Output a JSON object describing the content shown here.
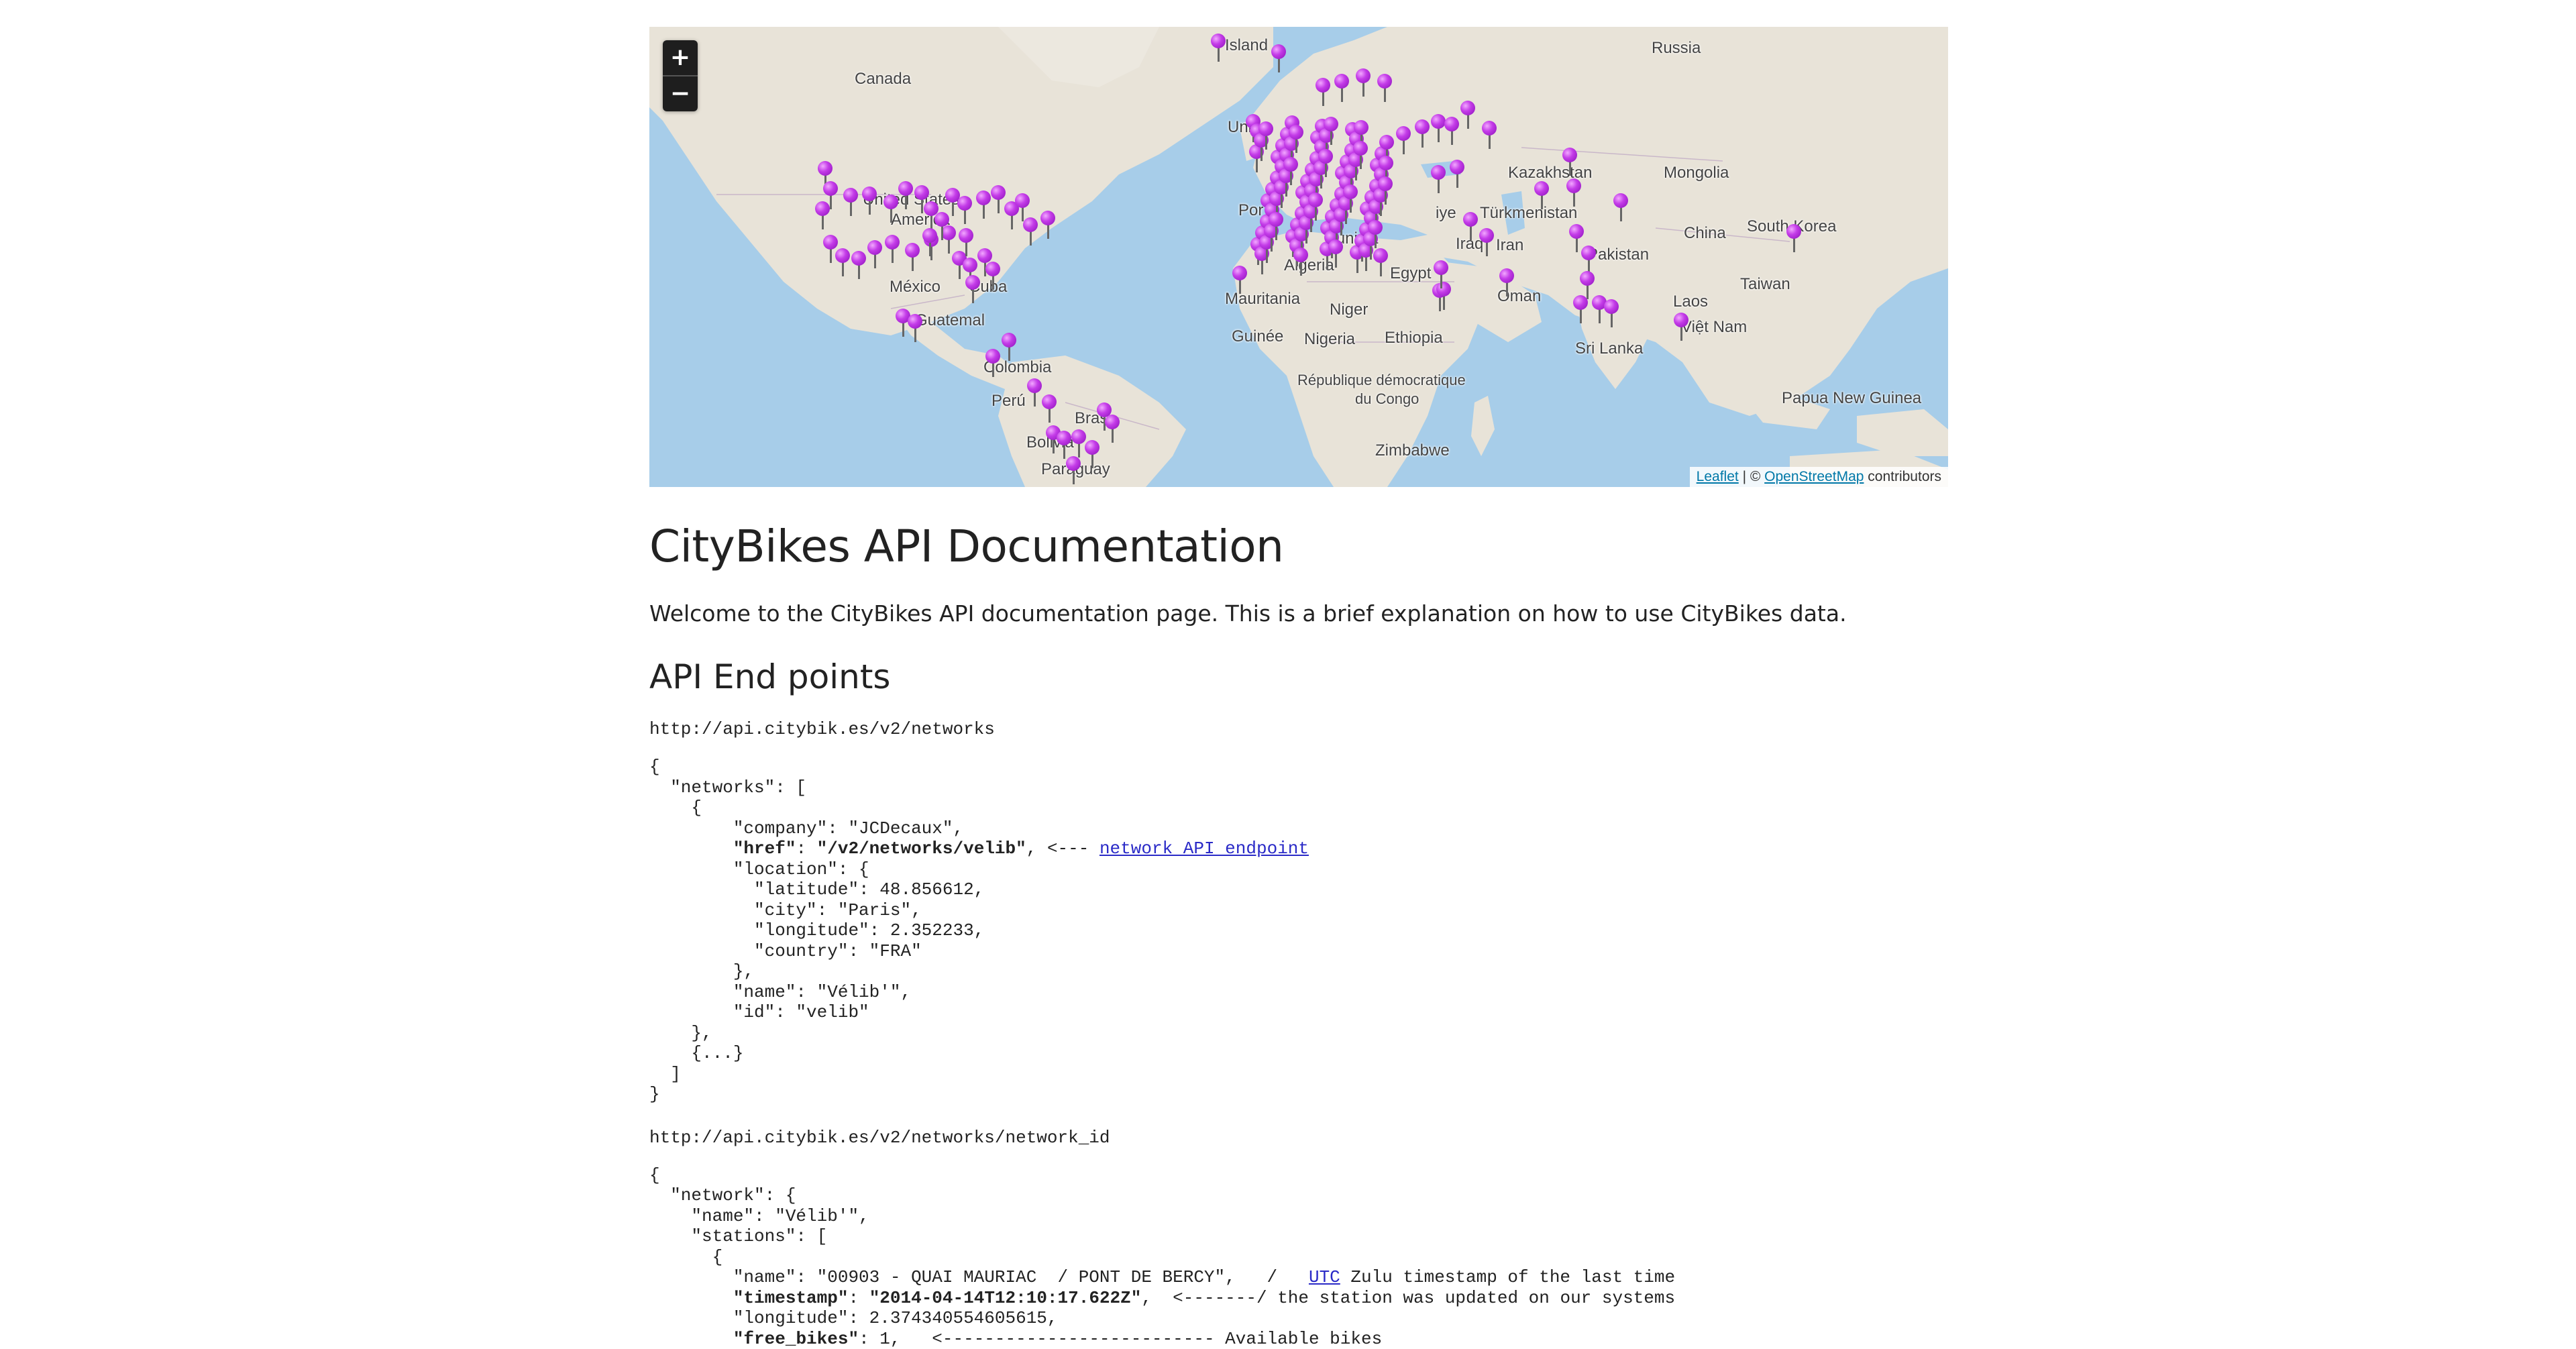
{
  "map": {
    "zoom_in": "+",
    "zoom_out": "−",
    "attribution": {
      "leaflet": "Leaflet",
      "separator": " | © ",
      "osm": "OpenStreetMap",
      "suffix": " contributors"
    },
    "labels": {
      "iceland": "Island",
      "russia": "Russia",
      "canada": "Canada",
      "united_kingdom": "Unit",
      "kazakhstan": "Kazakhstan",
      "mongolia": "Mongolia",
      "turkmenistan": "Türkmenistan",
      "united_states": "United States",
      "america": "America",
      "china": "China",
      "south_korea": "South Korea",
      "turkey": "iye",
      "portugal": "Por",
      "tunisia": "Tunisia",
      "iraq": "Iraq",
      "iran": "Iran",
      "pakistan": "Pakistan",
      "mexico": "México",
      "cuba": "Cuba",
      "algeria": "Algeria",
      "egypt": "Egypt",
      "taiwan": "Taiwan",
      "oman": "Oman",
      "guatemala": "Guatemal",
      "mauritania": "Mauritania",
      "niger": "Niger",
      "laos": "Laos",
      "vietnam": "Việt Nam",
      "colombia": "Colombia",
      "guinea": "Guinée",
      "nigeria": "Nigeria",
      "ethiopia": "Ethiopia",
      "sri_lanka": "Sri Lanka",
      "drc1": "République démocratique",
      "drc2": "du Congo",
      "peru": "Perú",
      "papua": "Papua New Guinea",
      "brazil": "Bras",
      "bolivia": "Bolivia",
      "zimbabwe": "Zimbabwe",
      "paraguay": "Paraguay"
    }
  },
  "doc": {
    "title": "CityBikes API Documentation",
    "intro": "Welcome to the CityBikes API documentation page. This is a brief explanation on how to use CityBikes data.",
    "endpoints_heading": "API End points",
    "endpoint1_url": "http://api.citybik.es/v2/networks",
    "endpoint2_url": "http://api.citybik.es/v2/networks/network_id",
    "code1": {
      "l1": "{",
      "l2": "  \"networks\": [",
      "l3": "    {",
      "l4": "        \"company\": \"JCDecaux\",",
      "l5_key": "\"href\"",
      "l5_sep": ": ",
      "l5_val": "\"/v2/networks/velib\"",
      "l5_after": ", <--- ",
      "l5_link": "network API endpoint",
      "l6": "        \"location\": {",
      "l7": "          \"latitude\": 48.856612,",
      "l8": "          \"city\": \"Paris\",",
      "l9": "          \"longitude\": 2.352233,",
      "l10": "          \"country\": \"FRA\"",
      "l11": "        },",
      "l12": "        \"name\": \"Vélib'\",",
      "l13": "        \"id\": \"velib\"",
      "l14": "    },",
      "l15": "    {...}",
      "l16": "  ]",
      "l17": "}"
    },
    "code2": {
      "l1": "{",
      "l2": "  \"network\": {",
      "l3": "    \"name\": \"Vélib'\",",
      "l4": "    \"stations\": [",
      "l5": "      {",
      "l6": "        \"name\": \"00903 - QUAI MAURIAC  / PONT DE BERCY\",   /   ",
      "l6_link": "UTC",
      "l6_after": " Zulu timestamp of the last time",
      "l7_key": "\"timestamp\"",
      "l7_sep": ": ",
      "l7_val": "\"2014-04-14T12:10:17.622Z\"",
      "l7_after": ",  <-------/ the station was updated on our systems",
      "l8": "        \"longitude\": 2.374340554605615,",
      "l9_key": "\"free_bikes\"",
      "l9_after": ": 1,   <-------------------------- Available bikes"
    }
  }
}
